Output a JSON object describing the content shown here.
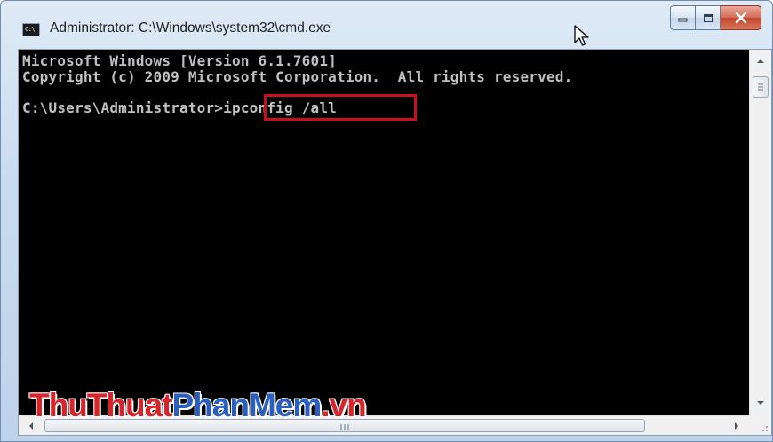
{
  "window": {
    "title": "Administrator: C:\\Windows\\system32\\cmd.exe",
    "app_icon_text": "C:\\",
    "controls": {
      "minimize": "minimize",
      "maximize": "maximize",
      "close": "close"
    }
  },
  "console": {
    "lines": [
      "Microsoft Windows [Version 6.1.7601]",
      "Copyright (c) 2009 Microsoft Corporation.  All rights reserved.",
      "",
      "C:\\Users\\Administrator>ipconfig /all"
    ],
    "prompt": "C:\\Users\\Administrator>",
    "command": "ipconfig /all",
    "highlight_color": "#c4111b",
    "text_color": "#c0c0c0",
    "background_color": "#000000"
  },
  "watermark": {
    "part1": "ThuThuat",
    "part2": "PhanMem",
    "part3": ".vn",
    "colors": {
      "red": "#d7242a",
      "blue": "#2b5fbf"
    }
  },
  "icons": {
    "scroll_up": "arrow-up-icon",
    "scroll_down": "arrow-down-icon",
    "scroll_left": "arrow-left-icon",
    "scroll_right": "arrow-right-icon",
    "mouse_cursor": "mouse-cursor-icon"
  }
}
